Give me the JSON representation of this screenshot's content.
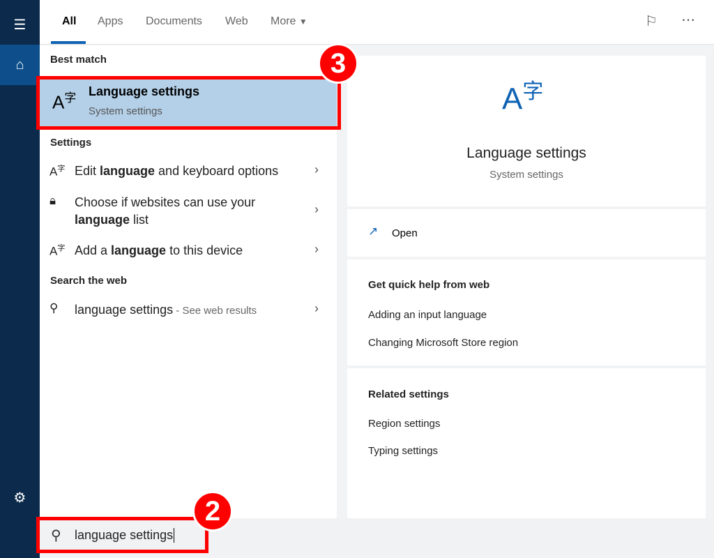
{
  "tabs": [
    "All",
    "Apps",
    "Documents",
    "Web",
    "More"
  ],
  "sections": {
    "best": "Best match",
    "settings": "Settings",
    "web": "Search the web"
  },
  "best_match": {
    "title": "Language settings",
    "subtitle": "System settings"
  },
  "settings_items": [
    {
      "pre": "Edit ",
      "bold": "language",
      "post": " and keyboard options"
    },
    {
      "pre": "Choose if websites can use your ",
      "bold": "language",
      "post": " list"
    },
    {
      "pre": "Add a ",
      "bold": "language",
      "post": " to this device"
    }
  ],
  "web_item": {
    "query": "language settings",
    "suffix": " - See web results"
  },
  "preview": {
    "title": "Language settings",
    "subtitle": "System settings",
    "open": "Open",
    "quick_help": "Get quick help from web",
    "help_links": [
      "Adding an input language",
      "Changing Microsoft Store region"
    ],
    "related": "Related settings",
    "related_links": [
      "Region settings",
      "Typing settings"
    ]
  },
  "search": {
    "value": "language settings"
  },
  "annotations": {
    "step_search": "2",
    "step_result": "3"
  },
  "colors": {
    "sidebar": "#0c2b4c",
    "accent": "#0f63b4",
    "highlight": "#b4d0e8",
    "annotation": "#ff0000"
  }
}
